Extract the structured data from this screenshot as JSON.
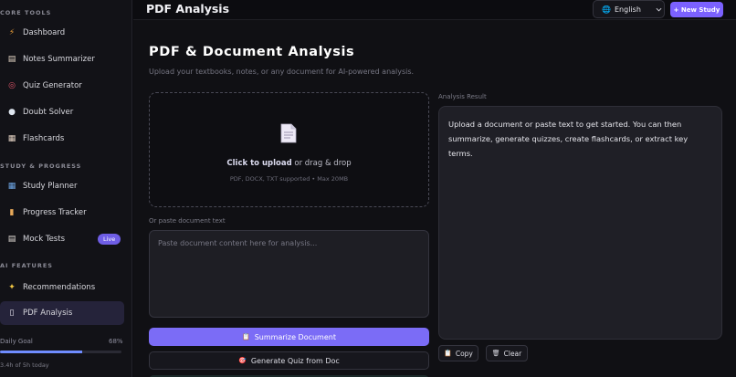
{
  "sidebar": {
    "sections": [
      {
        "title": "CORE TOOLS",
        "items": [
          {
            "label": "Dashboard",
            "icon": "lightning-icon",
            "glyph": "⚡",
            "color": "#f2a33a"
          },
          {
            "label": "Notes Summarizer",
            "icon": "notepad-icon",
            "glyph": "▤",
            "color": "#e8d9c8"
          },
          {
            "label": "Quiz Generator",
            "icon": "target-icon",
            "glyph": "◎",
            "color": "#e2566b"
          },
          {
            "label": "Doubt Solver",
            "icon": "speech-bubble-icon",
            "glyph": "●",
            "color": "#dfe6f0"
          },
          {
            "label": "Flashcards",
            "icon": "cards-icon",
            "glyph": "▦",
            "color": "#e4d2c3"
          }
        ]
      },
      {
        "title": "STUDY & PROGRESS",
        "items": [
          {
            "label": "Study Planner",
            "icon": "calendar-icon",
            "glyph": "▦",
            "color": "#6fa8e8"
          },
          {
            "label": "Progress Tracker",
            "icon": "bar-chart-icon",
            "glyph": "▮",
            "color": "#e8a95a"
          },
          {
            "label": "Mock Tests",
            "icon": "clipboard-icon",
            "glyph": "▤",
            "color": "#e6e0da",
            "badge": "Live"
          }
        ]
      },
      {
        "title": "AI FEATURES",
        "items": [
          {
            "label": "Recommendations",
            "icon": "sparkle-icon",
            "glyph": "✦",
            "color": "#f2c744"
          },
          {
            "label": "PDF Analysis",
            "icon": "document-icon",
            "glyph": "▯",
            "color": "#e8e4f0",
            "active": true
          }
        ]
      }
    ],
    "daily_goal": {
      "label": "Daily Goal",
      "percent_text": "68%",
      "progress": 0.68,
      "sub": "3.4h of 5h today"
    }
  },
  "header": {
    "title": "PDF Analysis",
    "language": "English",
    "new_study_label": "+ New Study"
  },
  "main": {
    "heading": "PDF & Document Analysis",
    "subtitle": "Upload your textbooks, notes, or any document for AI-powered analysis.",
    "upload": {
      "click_text": "Click to upload",
      "rest_text": " or drag & drop",
      "hint": "PDF, DOCX, TXT supported • Max 20MB"
    },
    "paste_label": "Or paste document text",
    "paste_placeholder": "Paste document content here for analysis...",
    "summarize_label": "Summarize Document",
    "quiz_label": "Generate Quiz from Doc",
    "result_label": "Analysis Result",
    "result_text": "Upload a document or paste text to get started. You can then summarize, generate quizzes, create flashcards, or extract key terms.",
    "copy_label": "Copy",
    "clear_label": "Clear"
  },
  "colors": {
    "accent": "#7b61ff",
    "background": "#0c0c10",
    "panel": "#1f1f26"
  }
}
